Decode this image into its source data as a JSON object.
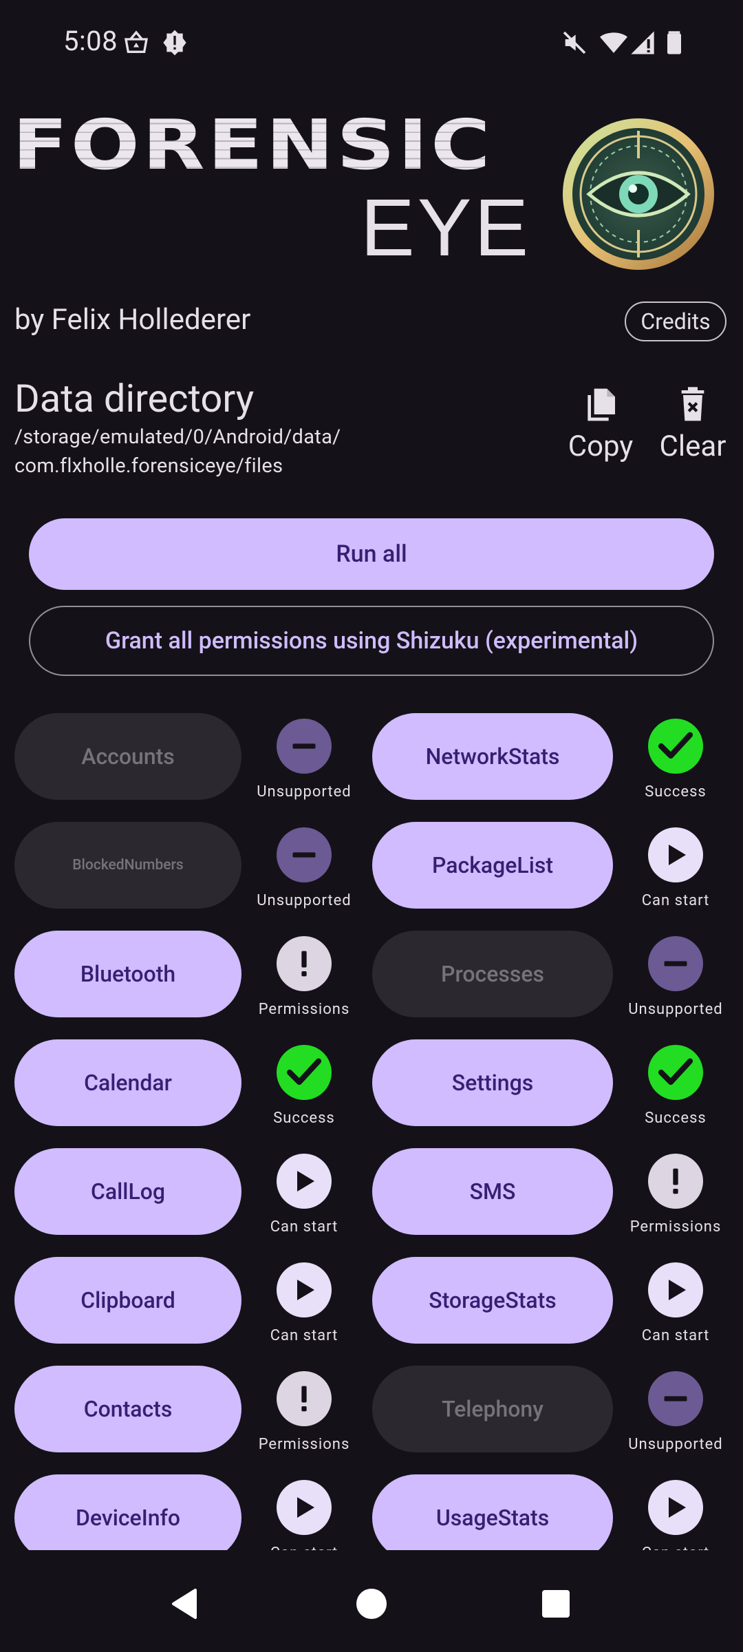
{
  "status_bar": {
    "time": "5:08",
    "left_icons": [
      "shopping-basket-icon",
      "alert-badge-icon"
    ],
    "right_icons": [
      "mute-icon",
      "wifi-icon",
      "signal-icon",
      "battery-icon"
    ]
  },
  "header": {
    "title_line1": "FORENSIC",
    "title_line2": "EYE",
    "logo_icon": "eye-logo-icon",
    "author": "by Felix Hollederer",
    "credits_label": "Credits"
  },
  "data_directory": {
    "title": "Data directory",
    "path_line1": "/storage/emulated/0/Android/data/",
    "path_line2": "com.flxholle.forensiceye/files",
    "copy_label": "Copy",
    "clear_label": "Clear"
  },
  "actions": {
    "run_all": "Run all",
    "grant_all": "Grant all permissions using Shizuku (experimental)"
  },
  "colors": {
    "primary": "#d0bcff",
    "on_primary": "#381e72",
    "background": "#141218",
    "success": "#22dd22",
    "unsupported": "#6c5a94"
  },
  "modules": [
    {
      "name": "Accounts",
      "enabled": false,
      "status": "Unsupported"
    },
    {
      "name": "NetworkStats",
      "enabled": true,
      "status": "Success"
    },
    {
      "name": "BlockedNumbers",
      "enabled": false,
      "status": "Unsupported"
    },
    {
      "name": "PackageList",
      "enabled": true,
      "status": "Can start"
    },
    {
      "name": "Bluetooth",
      "enabled": true,
      "status": "Permissions"
    },
    {
      "name": "Processes",
      "enabled": false,
      "status": "Unsupported"
    },
    {
      "name": "Calendar",
      "enabled": true,
      "status": "Success"
    },
    {
      "name": "Settings",
      "enabled": true,
      "status": "Success"
    },
    {
      "name": "CallLog",
      "enabled": true,
      "status": "Can start"
    },
    {
      "name": "SMS",
      "enabled": true,
      "status": "Permissions"
    },
    {
      "name": "Clipboard",
      "enabled": true,
      "status": "Can start"
    },
    {
      "name": "StorageStats",
      "enabled": true,
      "status": "Can start"
    },
    {
      "name": "Contacts",
      "enabled": true,
      "status": "Permissions"
    },
    {
      "name": "Telephony",
      "enabled": false,
      "status": "Unsupported"
    },
    {
      "name": "DeviceInfo",
      "enabled": true,
      "status": "Can start"
    },
    {
      "name": "UsageStats",
      "enabled": true,
      "status": "Can start"
    }
  ],
  "nav": {
    "back_icon": "back-triangle-icon",
    "home_icon": "home-circle-icon",
    "recents_icon": "recents-square-icon"
  }
}
